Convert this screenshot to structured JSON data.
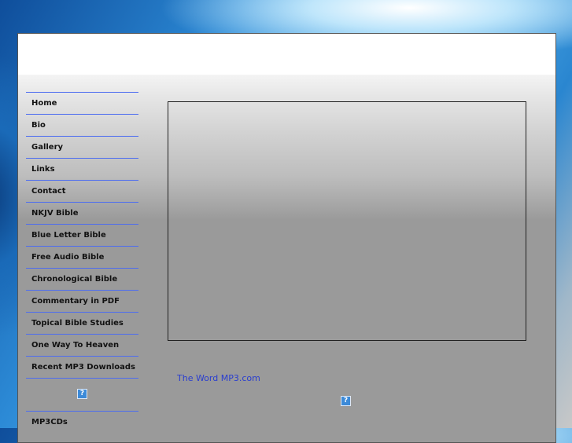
{
  "nav": {
    "items": [
      {
        "label": "Home"
      },
      {
        "label": "Bio"
      },
      {
        "label": "Gallery"
      },
      {
        "label": "Links"
      },
      {
        "label": "Contact"
      },
      {
        "label": "NKJV Bible"
      },
      {
        "label": "Blue Letter Bible"
      },
      {
        "label": "Free Audio Bible"
      },
      {
        "label": "Chronological Bible"
      },
      {
        "label": "Commentary in PDF"
      },
      {
        "label": "Topical Bible Studies"
      },
      {
        "label": "One Way To Heaven"
      },
      {
        "label": "Recent MP3 Downloads"
      }
    ],
    "placeholder_icon": "?",
    "after_icon": [
      {
        "label": "MP3CDs"
      }
    ]
  },
  "main": {
    "link_text": "The Word MP3.com",
    "placeholder_icon": "?"
  },
  "colors": {
    "nav_divider": "#4c6cf0",
    "link": "#2a3ecf"
  }
}
